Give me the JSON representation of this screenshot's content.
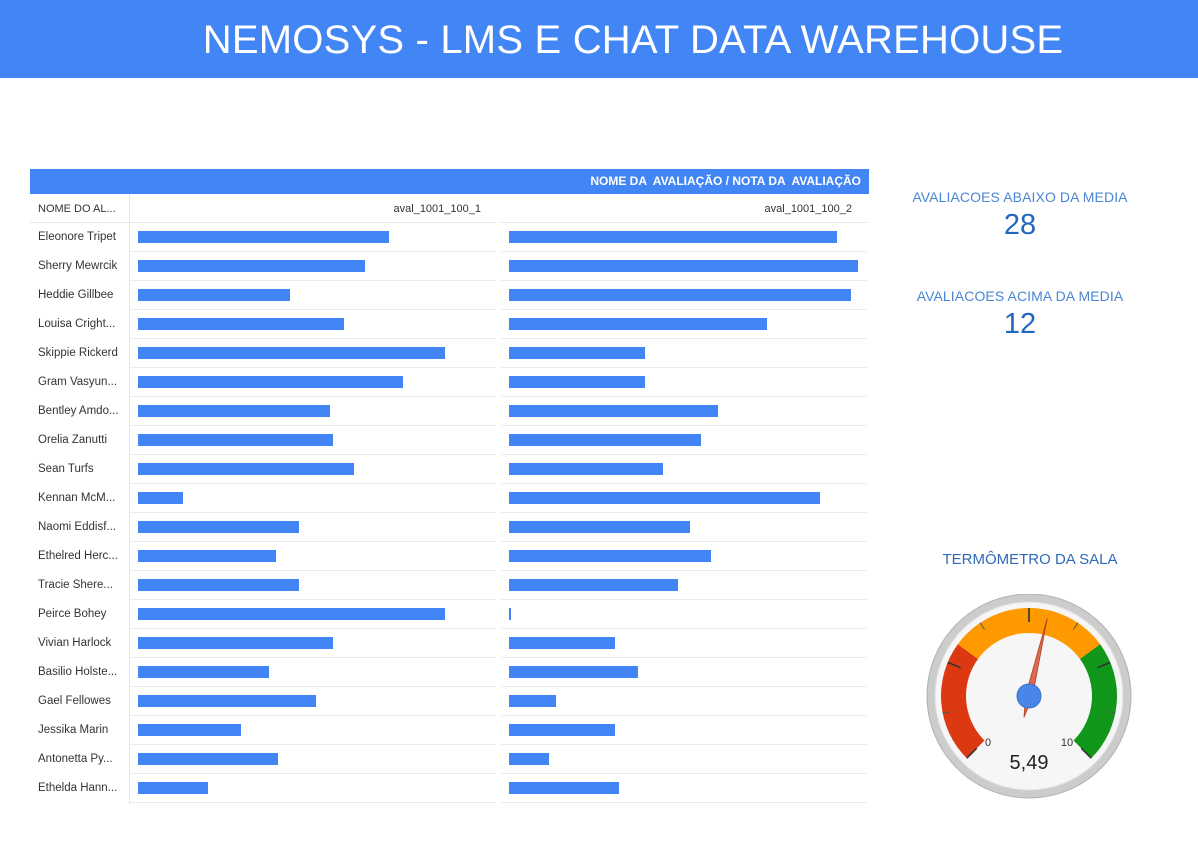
{
  "header": {
    "title": "NEMOSYS - LMS E CHAT DATA WAREHOUSE"
  },
  "table": {
    "banner": "NOME DA  AVALIAÇÃO / NOTA DA  AVALIAÇÃO",
    "name_header": "NOME DO AL...",
    "col1_header": "aval_1001_100_1",
    "col2_header": "aval_1001_100_2"
  },
  "chart_data": {
    "type": "bar",
    "title": "NOME DA  AVALIAÇÃO / NOTA DA  AVALIAÇÃO",
    "categories": [
      "Eleonore Tripet",
      "Sherry Mewrcik",
      "Heddie Gillbee",
      "Louisa Cright...",
      "Skippie Rickerd",
      "Gram Vasyun...",
      "Bentley Amdo...",
      "Orelia Zanutti",
      "Sean Turfs",
      "Kennan McM...",
      "Naomi Eddisf...",
      "Ethelred Herc...",
      "Tracie Shere...",
      "Peirce Bohey",
      "Vivian Harlock",
      "Basilio Holste...",
      "Gael Fellowes",
      "Jessika Marin",
      "Antonetta Py...",
      "Ethelda Hann..."
    ],
    "series": [
      {
        "name": "aval_1001_100_1",
        "values": [
          72,
          65,
          43.5,
          59,
          88,
          76,
          55,
          56,
          62,
          13,
          46,
          39.5,
          46,
          88,
          56,
          37.5,
          51,
          29.5,
          40,
          20
        ]
      },
      {
        "name": "aval_1001_100_2",
        "values": [
          94,
          100,
          98,
          74,
          39,
          39,
          60,
          55,
          44,
          89,
          52,
          58,
          48.5,
          0.5,
          30.5,
          37,
          13.5,
          30.5,
          11.5,
          31.5
        ]
      }
    ],
    "xlim": [
      0,
      100
    ]
  },
  "scorecards": [
    {
      "label": "AVALIACOES ABAIXO DA MEDIA",
      "value": "28"
    },
    {
      "label": "AVALIACOES ACIMA DA MEDIA",
      "value": "12"
    }
  ],
  "gauge": {
    "title": "TERMÔMETRO DA SALA",
    "min": 0,
    "max": 10,
    "min_label": "0",
    "max_label": "10",
    "value": 5.49,
    "value_label": "5,49",
    "bands": [
      {
        "from": 0,
        "to": 3,
        "color": "#dc3912"
      },
      {
        "from": 3,
        "to": 7,
        "color": "#ff9900"
      },
      {
        "from": 7,
        "to": 10,
        "color": "#109618"
      }
    ]
  }
}
